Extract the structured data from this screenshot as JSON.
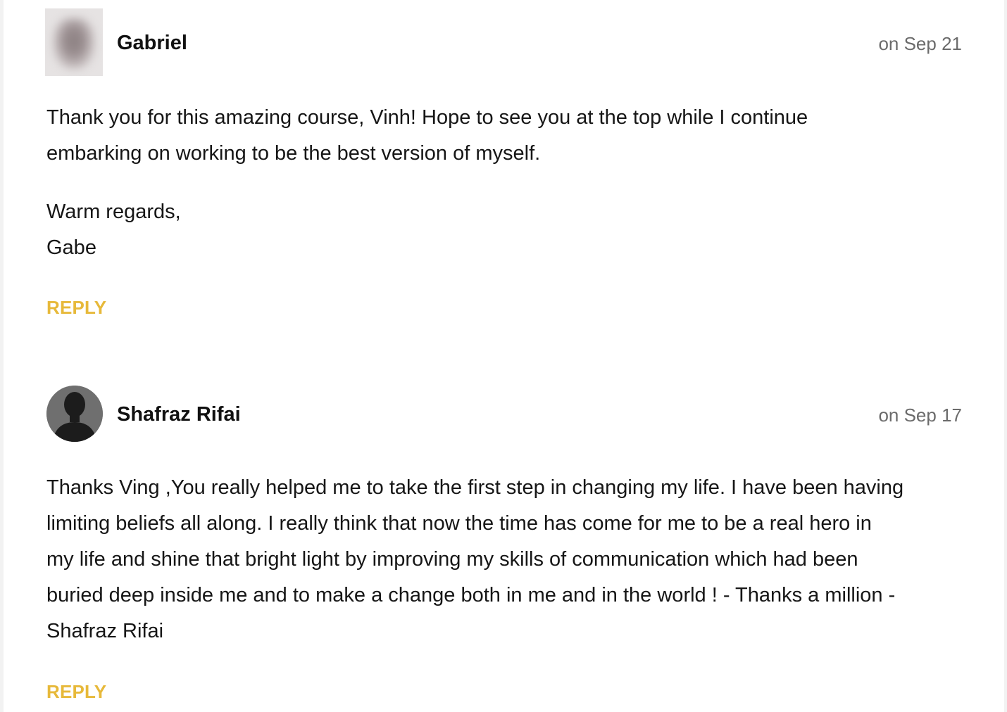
{
  "comments": [
    {
      "author": "Gabriel",
      "date": "on Sep 21",
      "avatar_icon": "blurred-photo-avatar",
      "lines": [
        "Thank you for this amazing course, Vinh! Hope to see you at the top while I continue",
        "embarking on working to be the best version of myself."
      ],
      "signoff": [
        "Warm regards,",
        "Gabe"
      ],
      "reply_label": "REPLY"
    },
    {
      "author": "Shafraz Rifai",
      "date": "on Sep 17",
      "avatar_icon": "default-user-avatar",
      "lines": [
        "Thanks Ving ,You really helped me to take the first step in changing my life. I have been having",
        "limiting beliefs all along. I really think that now the time has come for me to be a real hero in",
        "my life and shine that bright light by improving my skills of communication which had been",
        "buried deep inside me and to make a change both in me and in the world ! - Thanks a million -",
        "Shafraz Rifai"
      ],
      "reply_label": "REPLY"
    }
  ],
  "colors": {
    "reply": "#e7b93a",
    "date": "#6b6b6b",
    "text": "#161616"
  }
}
